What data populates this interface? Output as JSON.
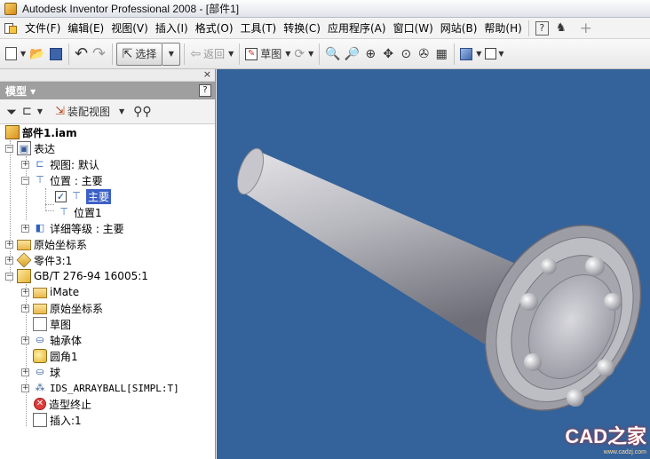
{
  "window": {
    "title": "Autodesk Inventor Professional 2008 - [部件1]"
  },
  "menu": {
    "items": [
      "文件(F)",
      "编辑(E)",
      "视图(V)",
      "插入(I)",
      "格式(O)",
      "工具(T)",
      "转换(C)",
      "应用程序(A)",
      "窗口(W)",
      "网站(B)",
      "帮助(H)"
    ]
  },
  "toolbar": {
    "select_label": "选择",
    "return_label": "返回",
    "sketch_label": "草图"
  },
  "panel": {
    "title": "模型 ▾",
    "help": "?",
    "close": "×",
    "assembly_view_label": "装配视图"
  },
  "tree": {
    "root": "部件1.iam",
    "representations": "表达",
    "view": "视图: 默认",
    "position": "位置 : 主要",
    "position_main": "主要",
    "position1": "位置1",
    "level_of_detail": "详细等级 : 主要",
    "origin": "原始坐标系",
    "part3": "零件3:1",
    "gb_part": "GB/T 276-94 16005:1",
    "imate": "iMate",
    "origin2": "原始坐标系",
    "sketch": "草图",
    "revolve": "轴承体",
    "fillet": "圆角1",
    "ball": "球",
    "pattern": "IDS_ARRAYBALL[SIMPL:T]",
    "end_of_part": "造型终止",
    "insert": "插入:1"
  },
  "watermark": {
    "logo": "CAD之家",
    "url": "www.cadzj.com"
  },
  "colors": {
    "viewport_bg": "#34629a",
    "panel_header": "#9f9f9f",
    "selection": "#3c61c6"
  }
}
